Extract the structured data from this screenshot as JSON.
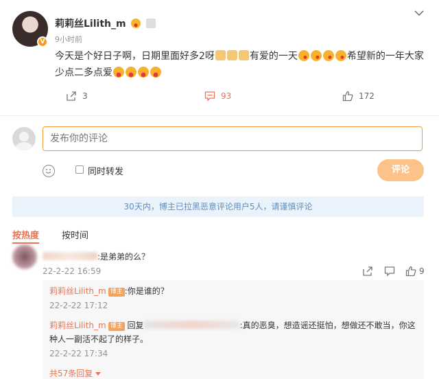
{
  "post": {
    "username": "莉莉丝Lilith_m",
    "time": "9小时前",
    "text_part1": "今天是个好日子啊，日期里面好多2呀",
    "text_part2": "有爱的一天",
    "text_part3": "希望新的一年大家少点二多点爱",
    "actions": {
      "share_count": "3",
      "comment_count": "93",
      "like_count": "172"
    }
  },
  "composer": {
    "placeholder": "发布你的评论",
    "forward_label": "同时转发",
    "submit_label": "评论"
  },
  "notice": "30天内，博主已拉黑恶意评论用户5人，请谨慎评论",
  "sort": {
    "hot": "按热度",
    "time": "按时间"
  },
  "comments": [
    {
      "text": ":是弟弟的么？",
      "time": "22-2-22 16:59",
      "like_count": "9",
      "replies": [
        {
          "name": "莉莉丝Lilith_m",
          "badge": "博主",
          "text": ":你是谁的？",
          "time": "22-2-22 17:12"
        },
        {
          "name": "莉莉丝Lilith_m",
          "badge": "博主",
          "reply_prefix": "回复",
          "text": ":真的恶臭，想造谣还挺怕，想做还不敢当，你这种人一副活不起了的样子。",
          "time": "22-2-22 17:34"
        }
      ],
      "more_replies": "共57条回复"
    }
  ],
  "colors": {
    "accent": "#eb7350",
    "notice_bg": "#eaf3fb",
    "notice_text": "#5e8fc0",
    "input_border": "#f29c3d"
  }
}
